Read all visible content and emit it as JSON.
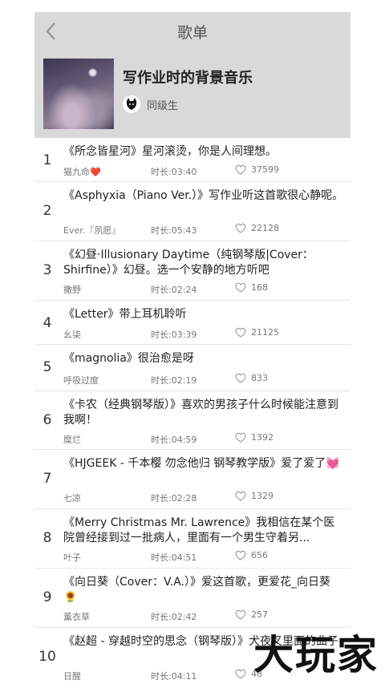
{
  "header": {
    "title": "歌单",
    "playlist_name": "写作业时的背景音乐",
    "creator": "同级生"
  },
  "songs": [
    {
      "index": "1",
      "title": "《所念皆星河》星河滚烫，你是人间理想。",
      "artist": "猫九命❤️",
      "duration": "时长:03:40",
      "likes": "37599"
    },
    {
      "index": "2",
      "title": "《Asphyxia（Piano Ver.）》写作业听这首歌很心静呢。",
      "artist": "Ever.『夙愿』",
      "duration": "时长:05:43",
      "likes": "22128"
    },
    {
      "index": "3",
      "title": "《幻昼·Illusionary Daytime（纯钢琴版|Cover：Shirfine）》幻昼。选一个安静的地方听吧",
      "artist": "撒野",
      "duration": "时长:02:24",
      "likes": "168"
    },
    {
      "index": "4",
      "title": "《Letter》带上耳机聆听",
      "artist": "幺柒",
      "duration": "时长:03:39",
      "likes": "21125"
    },
    {
      "index": "5",
      "title": "《magnolia》很治愈是呀",
      "artist": "呼吸过度",
      "duration": "时长:02:19",
      "likes": "833"
    },
    {
      "index": "6",
      "title": "《卡农（经典钢琴版）》喜欢的男孩子什么时候能注意到我啊！",
      "artist": "糜烂",
      "duration": "时长:04:59",
      "likes": "1392"
    },
    {
      "index": "7",
      "title": "《HJGEEK - 千本樱 勿念他归 钢琴教学版》爱了爱了💓",
      "artist": "七凉",
      "duration": "时长:02:28",
      "likes": "1329"
    },
    {
      "index": "8",
      "title": "《Merry Christmas Mr. Lawrence》我相信在某个医院曾经接到过一批病人，里面有一个男生守着另...",
      "artist": "叶子",
      "duration": "时长:04:51",
      "likes": "656"
    },
    {
      "index": "9",
      "title": "《向日葵（Cover：V.A.）》爱这首歌，更爱花_向日葵🌻",
      "artist": "薰衣草",
      "duration": "时长:02:42",
      "likes": "257"
    },
    {
      "index": "10",
      "title": "《赵超 - 穿越时空的思念（钢琴版）》犬夜叉里面的曲子",
      "artist": "日醒",
      "duration": "时长:04:11",
      "likes": "48"
    }
  ],
  "watermark": "大玩家",
  "colors": {
    "header_bg": "#d9d9d9",
    "heart_outline": "#999999"
  }
}
